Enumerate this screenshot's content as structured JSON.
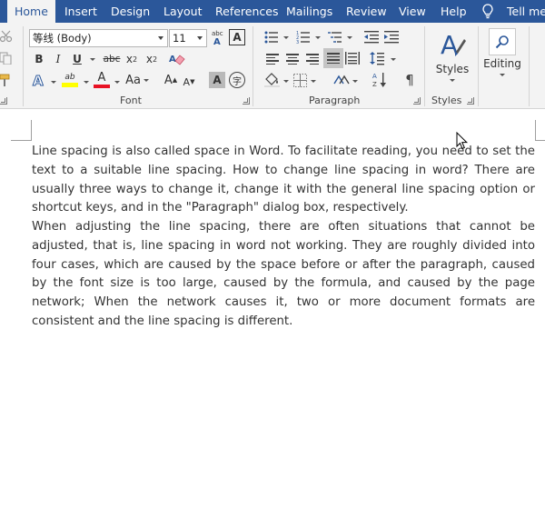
{
  "tabs": [
    {
      "label": "Home",
      "active": true
    },
    {
      "label": "Insert"
    },
    {
      "label": "Design"
    },
    {
      "label": "Layout"
    },
    {
      "label": "References"
    },
    {
      "label": "Mailings"
    },
    {
      "label": "Review"
    },
    {
      "label": "View"
    },
    {
      "label": "Help"
    },
    {
      "label": "Tell me"
    }
  ],
  "ribbon": {
    "font_name": "等线 (Body)",
    "font_size": "11",
    "groups": {
      "font": "Font",
      "paragraph": "Paragraph",
      "styles": "Styles"
    },
    "font_buttons": {
      "bold": "B",
      "italic": "I",
      "underline": "U",
      "strikethrough": "abc",
      "subscript_base": "x",
      "subscript": "2",
      "superscript_base": "x",
      "superscript": "2",
      "highlight": "ab",
      "font_color": "A",
      "change_case": "Aa",
      "grow": "A",
      "shrink": "A",
      "clear_format_glyph": "A",
      "char_shading": "A",
      "phonetic": "abc",
      "char_border": "A",
      "enclose": "字"
    },
    "styles_label": "Styles",
    "editing_label": "Editing",
    "pilcrow": "¶"
  },
  "colors": {
    "tab_bar": "#2b579a",
    "ribbon_bg": "#f3f3f3",
    "highlight_yellow": "#ffff00",
    "font_red": "#e81123",
    "accent_blue": "#2b579a"
  },
  "document": {
    "paragraphs": [
      "Line spacing is also called space in Word. To facilitate reading, you need to set the text to a suitable line spacing. How to change line spacing in word? There are usually three ways to change it, change it with the general line spacing option or shortcut keys, and in the \"Paragraph\" dialog box, respectively.",
      "When adjusting the line spacing, there are often situations that cannot be adjusted, that is, line spacing in word not working. They are roughly divided into four cases, which are caused by the space before or after the paragraph, caused by the font size is too large, caused by the formula, and caused by the page network; When the network causes it, two or more document formats are consistent and the line spacing is different."
    ]
  }
}
